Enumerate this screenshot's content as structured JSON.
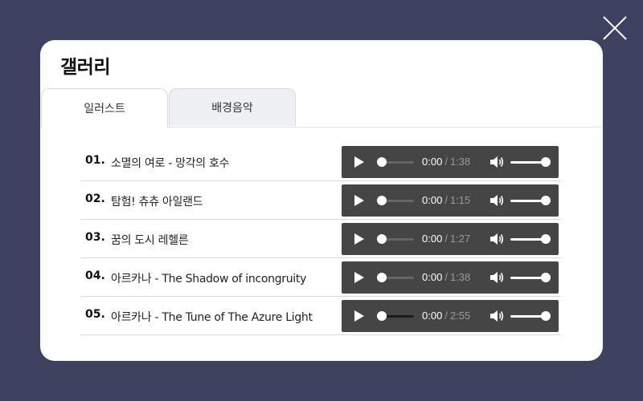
{
  "modal": {
    "title": "갤러리",
    "close_icon": "close-icon"
  },
  "tabs": [
    {
      "label": "일러스트",
      "active": true
    },
    {
      "label": "배경음악",
      "active": false
    }
  ],
  "tracks": [
    {
      "num": "01.",
      "title": "소멸의 여로 - 망각의 호수",
      "current": "0:00",
      "separator": "/",
      "duration": "1:38",
      "progress": 0,
      "volume": 1.0
    },
    {
      "num": "02.",
      "title": "탐험! 츄츄 아일랜드",
      "current": "0:00",
      "separator": "/",
      "duration": "1:15",
      "progress": 0,
      "volume": 1.0
    },
    {
      "num": "03.",
      "title": "꿈의 도시 레헬른",
      "current": "0:00",
      "separator": "/",
      "duration": "1:27",
      "progress": 0,
      "volume": 1.0
    },
    {
      "num": "04.",
      "title": "아르카나 - The Shadow of incongruity",
      "current": "0:00",
      "separator": "/",
      "duration": "1:38",
      "progress": 0,
      "volume": 1.0
    },
    {
      "num": "05.",
      "title": "아르카나 - The Tune of The Azure Light",
      "current": "0:00",
      "separator": "/",
      "duration": "2:55",
      "progress": 0,
      "volume": 1.0
    }
  ],
  "colors": {
    "backdrop": "#3e4160",
    "player_bg": "#454545",
    "active_tab_bg": "#ffffff",
    "inactive_tab_bg": "#eff0f4"
  }
}
